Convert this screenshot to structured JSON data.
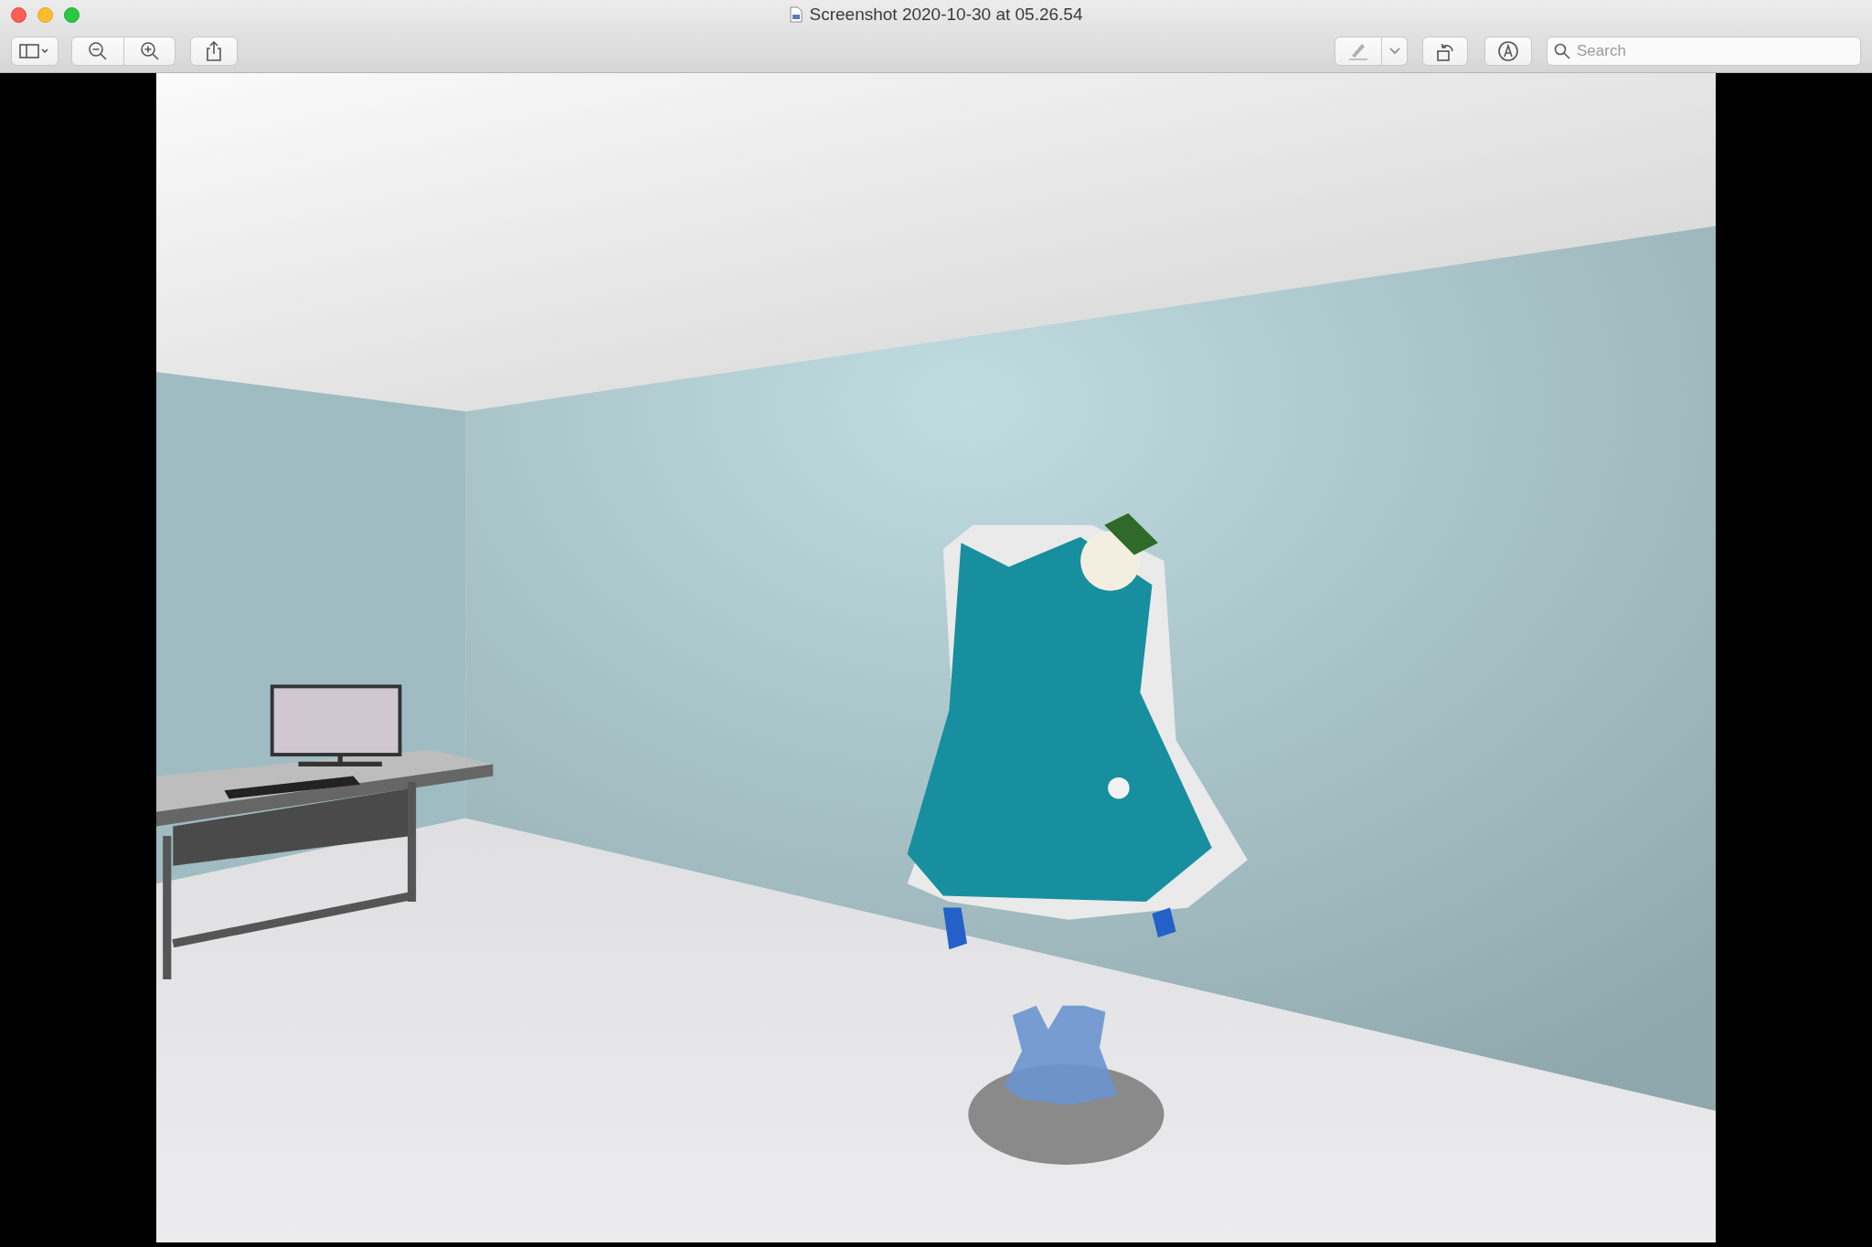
{
  "window": {
    "title": "Screenshot 2020-10-30 at 05.26.54"
  },
  "search": {
    "placeholder": "Search"
  }
}
